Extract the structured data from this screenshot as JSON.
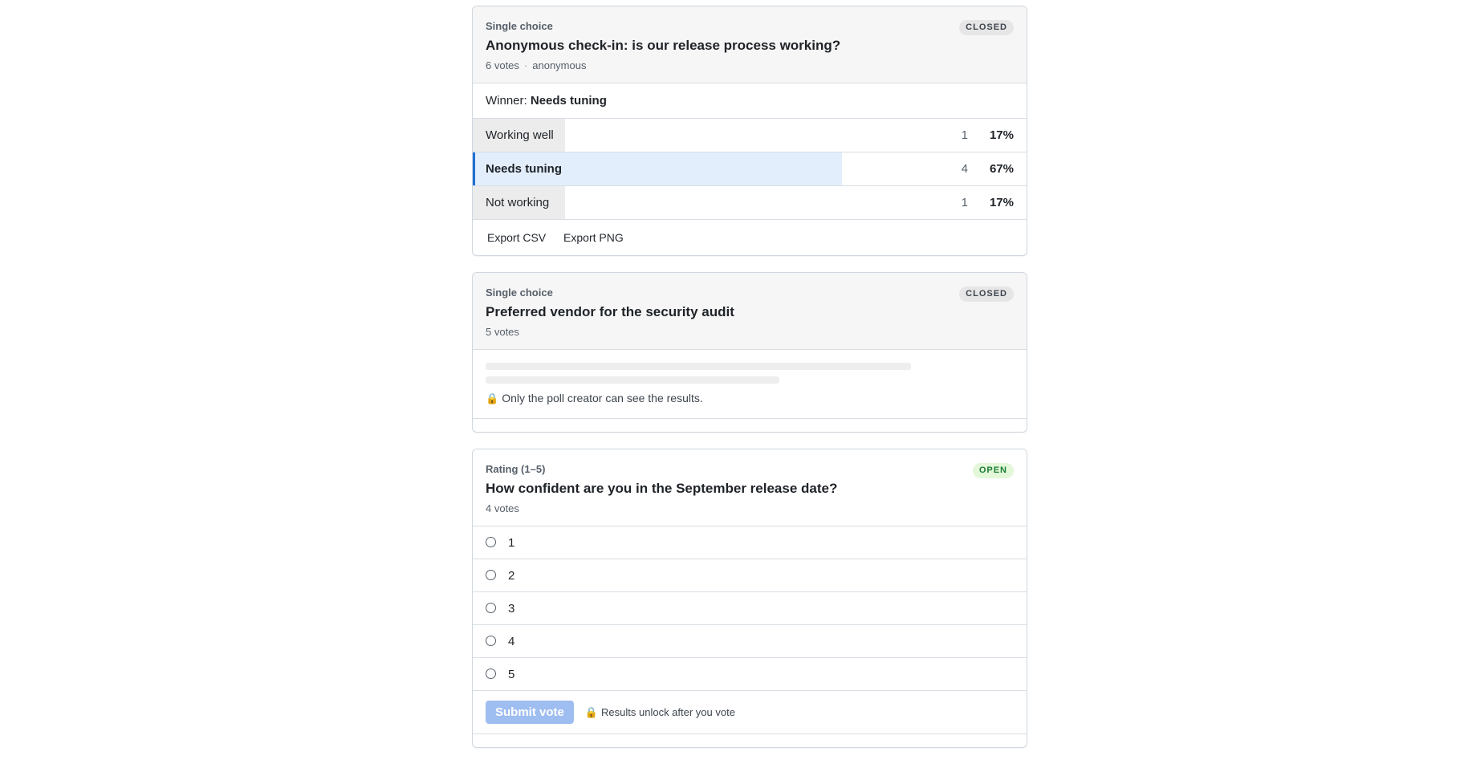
{
  "polls": [
    {
      "type": "Single choice",
      "title": "Anonymous check-in: is our release process working?",
      "votes": "6 votes",
      "meta_separator": "·",
      "visibility": "anonymous",
      "status": "CLOSED",
      "winner_prefix": "Winner:",
      "winner": "Needs tuning",
      "options": [
        {
          "label": "Working well",
          "count": "1",
          "percent": "17%",
          "fraction": 0.167,
          "winner": false
        },
        {
          "label": "Needs tuning",
          "count": "4",
          "percent": "67%",
          "fraction": 0.667,
          "winner": true
        },
        {
          "label": "Not working",
          "count": "1",
          "percent": "17%",
          "fraction": 0.167,
          "winner": false
        }
      ],
      "actions": [
        "Export CSV",
        "Export PNG"
      ]
    },
    {
      "type": "Single choice",
      "title": "Preferred vendor for the security audit",
      "votes": "5 votes",
      "status": "CLOSED",
      "lock_icon": "lock-icon",
      "locked_message": "Only the poll creator can see the results."
    },
    {
      "type": "Rating (1–5)",
      "title": "How confident are you in the September release date?",
      "votes": "4 votes",
      "status": "OPEN",
      "ratings": [
        "1",
        "2",
        "3",
        "4",
        "5"
      ],
      "submit_label": "Submit vote",
      "lock_icon": "lock-icon",
      "unlock_message": "Results unlock after you vote"
    }
  ],
  "colors": {
    "winner_accent": "#1f6fd6",
    "winner_fill": "#e3eefc",
    "open_badge": "#1a7f37",
    "submit_disabled": "#9ebdf0"
  }
}
